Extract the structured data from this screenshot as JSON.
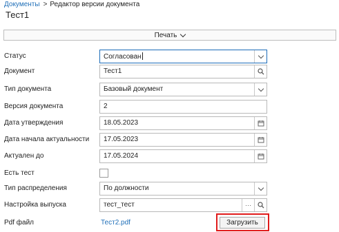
{
  "breadcrumb": {
    "root": "Документы",
    "separator": ">",
    "current": "Редактор версии документа"
  },
  "page_title": "Тест1",
  "print_menu": {
    "label": "Печать",
    "icon": "chevron-down-icon"
  },
  "form": {
    "status": {
      "label": "Статус",
      "value": "Согласован"
    },
    "document": {
      "label": "Документ",
      "value": "Тест1"
    },
    "doc_type": {
      "label": "Тип документа",
      "value": "Базовый документ"
    },
    "doc_version": {
      "label": "Версия документа",
      "value": "2"
    },
    "approval_date": {
      "label": "Дата утверждения",
      "value": "18.05.2023"
    },
    "actual_start": {
      "label": "Дата начала актуальности",
      "value": "17.05.2023"
    },
    "actual_until": {
      "label": "Актуален до",
      "value": "17.05.2024"
    },
    "has_test": {
      "label": "Есть тест",
      "checked": false
    },
    "distribution_type": {
      "label": "Тип распределения",
      "value": "По должности"
    },
    "release_setting": {
      "label": "Настройка выпуска",
      "value": "тест_тест",
      "more_button": "···"
    },
    "pdf_file": {
      "label": "Pdf файл",
      "file_name": "Тест2.pdf",
      "upload_button": "Загрузить"
    }
  },
  "colors": {
    "link": "#1f6fb8",
    "focus_border": "#1b6bb8",
    "highlight": "#e01a1a"
  }
}
